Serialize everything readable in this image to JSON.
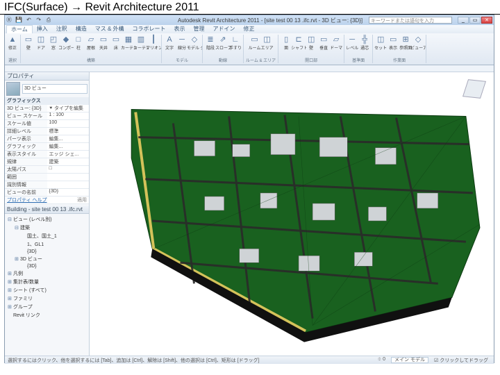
{
  "caption": "IFC(Surface)  →  Revit Architecture 2011",
  "titlebar": {
    "title": "Autodesk Revit Architecture 2011 - [site test 00 13 .ifc.rvt - 3D ビュー: {3D}]",
    "search_placeholder": "キーワードまたは語句を入力",
    "min": "_",
    "max": "▭",
    "close": "✕"
  },
  "ribbon_tabs": [
    "ホーム",
    "挿入",
    "注釈",
    "構造",
    "マス & 外構",
    "コラボレート",
    "表示",
    "管理",
    "アドイン",
    "修正"
  ],
  "ribbon_groups": [
    {
      "label": "選択",
      "items": [
        {
          "glyph": "▲",
          "lbl": "修正"
        }
      ]
    },
    {
      "label": "構築",
      "items": [
        {
          "glyph": "▭",
          "lbl": "壁"
        },
        {
          "glyph": "◫",
          "lbl": "ドア"
        },
        {
          "glyph": "◰",
          "lbl": "窓"
        },
        {
          "glyph": "◆",
          "lbl": "コンポーネント"
        },
        {
          "glyph": "□",
          "lbl": "柱"
        },
        {
          "glyph": "▱",
          "lbl": "屋根"
        },
        {
          "glyph": "▭",
          "lbl": "天井"
        },
        {
          "glyph": "▭",
          "lbl": "床"
        },
        {
          "glyph": "▦",
          "lbl": "カーテン システム"
        },
        {
          "glyph": "▥",
          "lbl": "カーテン グリッド"
        },
        {
          "glyph": "┃",
          "lbl": "マリオン"
        }
      ]
    },
    {
      "label": "モデル",
      "items": [
        {
          "glyph": "A",
          "lbl": "文字"
        },
        {
          "glyph": "─",
          "lbl": "線分"
        },
        {
          "glyph": "◇",
          "lbl": "モデル グループ"
        }
      ]
    },
    {
      "label": "動線",
      "items": [
        {
          "glyph": "≣",
          "lbl": "階段"
        },
        {
          "glyph": "⇗",
          "lbl": "スロープ"
        },
        {
          "glyph": "∟",
          "lbl": "手すり"
        }
      ]
    },
    {
      "label": "ルーム & エリア",
      "items": [
        {
          "glyph": "▭",
          "lbl": "ルーム"
        },
        {
          "glyph": "◫",
          "lbl": "エリア"
        }
      ]
    },
    {
      "label": "開口部",
      "items": [
        {
          "glyph": "▯",
          "lbl": "面"
        },
        {
          "glyph": "⊏",
          "lbl": "シャフト"
        },
        {
          "glyph": "◫",
          "lbl": "壁"
        },
        {
          "glyph": "▭",
          "lbl": "垂直"
        },
        {
          "glyph": "▱",
          "lbl": "ドーマ"
        }
      ]
    },
    {
      "label": "基準面",
      "items": [
        {
          "glyph": "─",
          "lbl": "レベル"
        },
        {
          "glyph": "╬",
          "lbl": "通芯"
        }
      ]
    },
    {
      "label": "作業面",
      "items": [
        {
          "glyph": "◫",
          "lbl": "セット"
        },
        {
          "glyph": "▭",
          "lbl": "表示"
        },
        {
          "glyph": "⊞",
          "lbl": "参照面"
        },
        {
          "glyph": "◇",
          "lbl": "ビューア"
        }
      ]
    }
  ],
  "properties": {
    "panel_title": "プロパティ",
    "selector": "3D ビュー",
    "section": "グラフィックス",
    "rows": [
      {
        "k": "3D ビュー: {3D}",
        "v": "⯆ タイプを編集"
      },
      {
        "k": "ビュー スケール",
        "v": "1 : 100"
      },
      {
        "k": "スケール値",
        "v": "100"
      },
      {
        "k": "詳細レベル",
        "v": "標準"
      },
      {
        "k": "パーツ表示",
        "v": "編集..."
      },
      {
        "k": "グラフィック",
        "v": "編集..."
      },
      {
        "k": "表示スタイル",
        "v": "エッジ シェ..."
      },
      {
        "k": "規律",
        "v": "建築"
      },
      {
        "k": "太陽パス",
        "v": "□"
      },
      {
        "k": "範囲",
        "v": ""
      },
      {
        "k": "識別情報",
        "v": ""
      },
      {
        "k": "ビューの名前",
        "v": "{3D}"
      }
    ],
    "help": "プロパティ ヘルプ",
    "apply": "適用"
  },
  "browser": {
    "title": "Building - site test 00 13 .ifc.rvt",
    "nodes": [
      {
        "ind": 0,
        "tw": "⊟",
        "label": "ビュー (レベル別)"
      },
      {
        "ind": 1,
        "tw": "⊟",
        "label": "建築"
      },
      {
        "ind": 2,
        "tw": "",
        "label": "国土、国土_1"
      },
      {
        "ind": 2,
        "tw": "",
        "label": "1、GL1"
      },
      {
        "ind": 2,
        "tw": "",
        "label": "{3D}"
      },
      {
        "ind": 1,
        "tw": "⊞",
        "label": "3D ビュー"
      },
      {
        "ind": 2,
        "tw": "",
        "label": "{3D}"
      },
      {
        "ind": 0,
        "tw": "⊞",
        "label": "凡例"
      },
      {
        "ind": 0,
        "tw": "⊞",
        "label": "集計表/数量"
      },
      {
        "ind": 0,
        "tw": "⊞",
        "label": "シート (すべて)"
      },
      {
        "ind": 0,
        "tw": "⊞",
        "label": "ファミリ"
      },
      {
        "ind": 0,
        "tw": "⊞",
        "label": "グループ"
      },
      {
        "ind": 0,
        "tw": "",
        "label": "Revit リンク"
      }
    ]
  },
  "statusbar": {
    "hint": "選択するにはクリック、他を選択するには [Tab]、追加は [Ctrl]、解除は [Shift]、他の選択は [Ctrl]、矩形は [ドラッグ]",
    "zoom": "⯐ 0",
    "model_btn": "メイン モデル",
    "drag_hint": "クリックしてドラッグ"
  },
  "viewcube": {
    "facelabel": ""
  }
}
